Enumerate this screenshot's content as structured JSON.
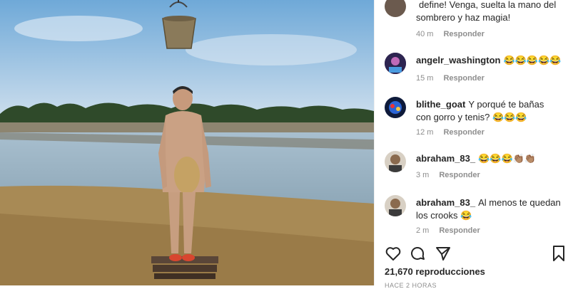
{
  "comments": [
    {
      "user": "",
      "text": "define! Venga, suelta la mano del sombrero y haz magia!",
      "time": "40 m",
      "reply": "Responder"
    },
    {
      "user": "angelr_washington",
      "text": "😂😂😂😂😂",
      "time": "15 m",
      "reply": "Responder"
    },
    {
      "user": "blithe_goat",
      "text": "Y porqué te bañas con gorro y tenis? 😂😂😂",
      "time": "12 m",
      "reply": "Responder"
    },
    {
      "user": "abraham_83_",
      "text": "😂😂😂👏🏽👏🏽",
      "time": "3 m",
      "reply": "Responder"
    },
    {
      "user": "abraham_83_",
      "text": "Al menos te quedan los crooks 😂",
      "time": "2 m",
      "reply": "Responder"
    }
  ],
  "actions": {
    "like_icon": "heart-icon",
    "comment_icon": "comment-icon",
    "share_icon": "paper-plane-icon",
    "save_icon": "bookmark-icon"
  },
  "stats": {
    "views": "21,670 reproducciones",
    "ago": "HACE 2 HORAS"
  },
  "colors": {
    "text": "#262626",
    "secondary": "#8e8e8e",
    "sky": "#7fb4dc",
    "water": "#9fb7c7",
    "ground": "#a88a55"
  }
}
